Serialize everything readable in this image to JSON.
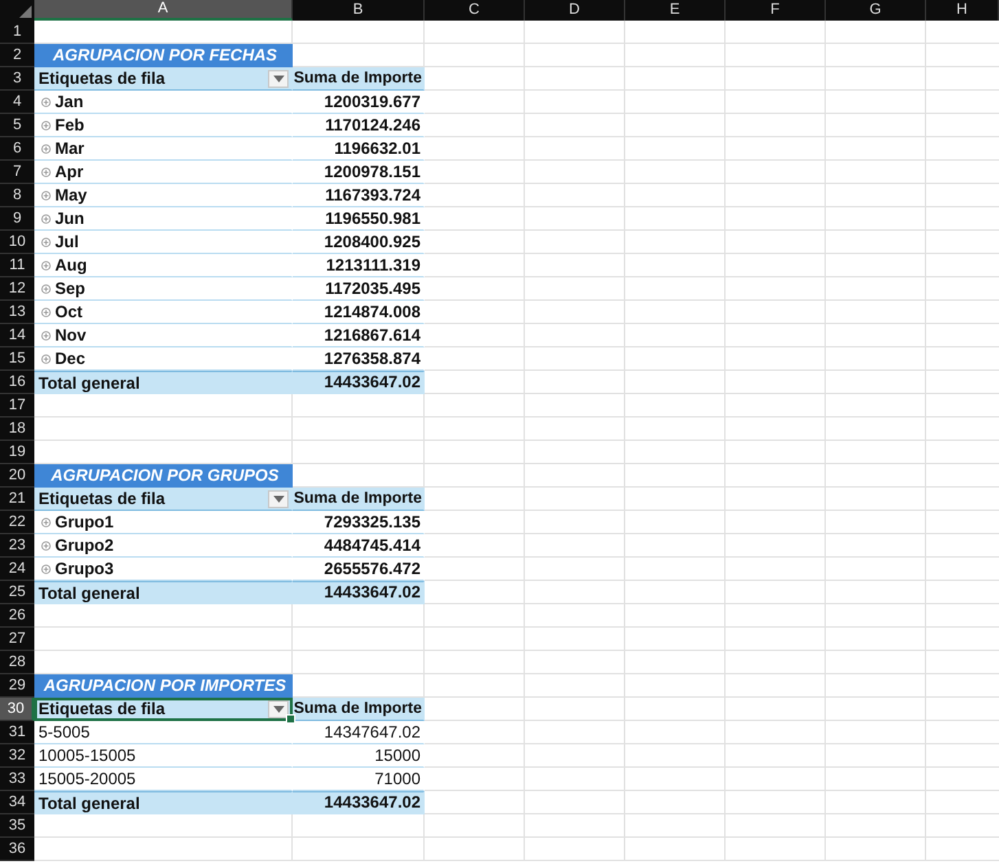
{
  "columns": [
    {
      "label": "A",
      "selected": true
    },
    {
      "label": "B",
      "selected": false
    },
    {
      "label": "C",
      "selected": false
    },
    {
      "label": "D",
      "selected": false
    },
    {
      "label": "E",
      "selected": false
    },
    {
      "label": "F",
      "selected": false
    },
    {
      "label": "G",
      "selected": false
    },
    {
      "label": "H",
      "selected": false
    }
  ],
  "rows": [
    {
      "number": "1",
      "selected": false,
      "kind": "blank"
    },
    {
      "number": "2",
      "selected": false,
      "kind": "title",
      "text": "AGRUPACION POR FECHAS"
    },
    {
      "number": "3",
      "selected": false,
      "kind": "header",
      "label": "Etiquetas de fila",
      "value": "Suma de Importe",
      "active": false
    },
    {
      "number": "4",
      "selected": false,
      "kind": "item",
      "label": "Jan",
      "value": "1200319.677",
      "expandable": true
    },
    {
      "number": "5",
      "selected": false,
      "kind": "item",
      "label": "Feb",
      "value": "1170124.246",
      "expandable": true
    },
    {
      "number": "6",
      "selected": false,
      "kind": "item",
      "label": "Mar",
      "value": "1196632.01",
      "expandable": true
    },
    {
      "number": "7",
      "selected": false,
      "kind": "item",
      "label": "Apr",
      "value": "1200978.151",
      "expandable": true
    },
    {
      "number": "8",
      "selected": false,
      "kind": "item",
      "label": "May",
      "value": "1167393.724",
      "expandable": true
    },
    {
      "number": "9",
      "selected": false,
      "kind": "item",
      "label": "Jun",
      "value": "1196550.981",
      "expandable": true
    },
    {
      "number": "10",
      "selected": false,
      "kind": "item",
      "label": "Jul",
      "value": "1208400.925",
      "expandable": true
    },
    {
      "number": "11",
      "selected": false,
      "kind": "item",
      "label": "Aug",
      "value": "1213111.319",
      "expandable": true
    },
    {
      "number": "12",
      "selected": false,
      "kind": "item",
      "label": "Sep",
      "value": "1172035.495",
      "expandable": true
    },
    {
      "number": "13",
      "selected": false,
      "kind": "item",
      "label": "Oct",
      "value": "1214874.008",
      "expandable": true
    },
    {
      "number": "14",
      "selected": false,
      "kind": "item",
      "label": "Nov",
      "value": "1216867.614",
      "expandable": true
    },
    {
      "number": "15",
      "selected": false,
      "kind": "item",
      "label": "Dec",
      "value": "1276358.874",
      "expandable": true
    },
    {
      "number": "16",
      "selected": false,
      "kind": "total",
      "label": "Total general",
      "value": "14433647.02"
    },
    {
      "number": "17",
      "selected": false,
      "kind": "blank"
    },
    {
      "number": "18",
      "selected": false,
      "kind": "blank"
    },
    {
      "number": "19",
      "selected": false,
      "kind": "blank"
    },
    {
      "number": "20",
      "selected": false,
      "kind": "title",
      "text": "AGRUPACION POR GRUPOS"
    },
    {
      "number": "21",
      "selected": false,
      "kind": "header",
      "label": "Etiquetas de fila",
      "value": "Suma de Importe",
      "active": false
    },
    {
      "number": "22",
      "selected": false,
      "kind": "item",
      "label": "Grupo1",
      "value": "7293325.135",
      "expandable": true
    },
    {
      "number": "23",
      "selected": false,
      "kind": "item",
      "label": "Grupo2",
      "value": "4484745.414",
      "expandable": true
    },
    {
      "number": "24",
      "selected": false,
      "kind": "item",
      "label": "Grupo3",
      "value": "2655576.472",
      "expandable": true
    },
    {
      "number": "25",
      "selected": false,
      "kind": "total",
      "label": "Total general",
      "value": "14433647.02"
    },
    {
      "number": "26",
      "selected": false,
      "kind": "blank"
    },
    {
      "number": "27",
      "selected": false,
      "kind": "blank"
    },
    {
      "number": "28",
      "selected": false,
      "kind": "blank"
    },
    {
      "number": "29",
      "selected": false,
      "kind": "title",
      "text": "AGRUPACION POR IMPORTES"
    },
    {
      "number": "30",
      "selected": true,
      "kind": "header",
      "label": "Etiquetas de fila",
      "value": "Suma de Importe",
      "active": true
    },
    {
      "number": "31",
      "selected": false,
      "kind": "item",
      "label": "5-5005",
      "value": "14347647.02",
      "expandable": false
    },
    {
      "number": "32",
      "selected": false,
      "kind": "item",
      "label": "10005-15005",
      "value": "15000",
      "expandable": false
    },
    {
      "number": "33",
      "selected": false,
      "kind": "item",
      "label": "15005-20005",
      "value": "71000",
      "expandable": false
    },
    {
      "number": "34",
      "selected": false,
      "kind": "total",
      "label": "Total general",
      "value": "14433647.02"
    },
    {
      "number": "35",
      "selected": false,
      "kind": "blank"
    },
    {
      "number": "36",
      "selected": false,
      "kind": "blank"
    }
  ]
}
